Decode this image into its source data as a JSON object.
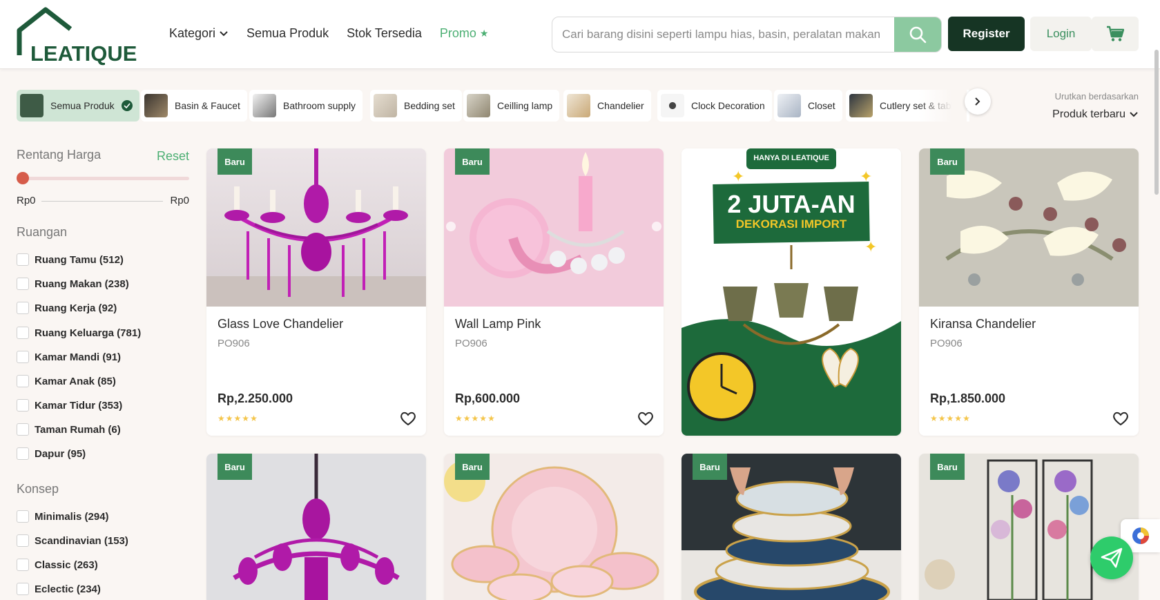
{
  "brand": {
    "name": "LEATIQUE",
    "color": "#1e5a3a"
  },
  "nav": {
    "kategori": "Kategori",
    "semua_produk": "Semua Produk",
    "stok_tersedia": "Stok Tersedia",
    "promo": "Promo"
  },
  "search": {
    "placeholder": "Cari barang disini seperti lampu hias, basin, peralatan makan",
    "icon": "search-icon"
  },
  "auth": {
    "register": "Register",
    "login": "Login",
    "cart_icon": "cart-icon"
  },
  "categories": [
    {
      "label": "Semua Produk",
      "active": true
    },
    {
      "label": "Basin & Faucet"
    },
    {
      "label": "Bathroom supply"
    },
    {
      "label": "Bedding set"
    },
    {
      "label": "Ceilling lamp"
    },
    {
      "label": "Chandelier"
    },
    {
      "label": "Clock Decoration"
    },
    {
      "label": "Closet"
    },
    {
      "label": "Cutlery set & tableware"
    }
  ],
  "sort": {
    "label": "Urutkan berdasarkan",
    "value": "Produk terbaru"
  },
  "filters": {
    "price": {
      "title": "Rentang Harga",
      "reset": "Reset",
      "min": "Rp0",
      "max": "Rp0"
    },
    "ruangan": {
      "title": "Ruangan",
      "items": [
        "Ruang Tamu (512)",
        "Ruang Makan (238)",
        "Ruang Kerja (92)",
        "Ruang Keluarga (781)",
        "Kamar Mandi (91)",
        "Kamar Anak (85)",
        "Kamar Tidur (353)",
        "Taman Rumah (6)",
        "Dapur (95)"
      ]
    },
    "konsep": {
      "title": "Konsep",
      "items": [
        "Minimalis (294)",
        "Scandinavian (153)",
        "Classic (263)",
        "Eclectic (234)"
      ]
    }
  },
  "products": [
    {
      "badge": "Baru",
      "name": "Glass Love Chandelier",
      "sku": "PO906",
      "price": "Rp,2.250.000",
      "rating": 5
    },
    {
      "badge": "Baru",
      "name": "Wall Lamp Pink",
      "sku": "PO906",
      "price": "Rp,600.000",
      "rating": 5
    },
    {
      "banner_top": "HANYA DI LEATIQUE",
      "banner_headline": "2 JUTA-AN",
      "banner_sub": "DEKORASI IMPORT"
    },
    {
      "badge": "Baru",
      "name": "Kiransa Chandelier",
      "sku": "PO906",
      "price": "Rp,1.850.000",
      "rating": 5
    },
    {
      "badge": "Baru"
    },
    {
      "badge": "Baru"
    },
    {
      "badge": "Baru"
    },
    {
      "badge": "Baru"
    }
  ],
  "colors": {
    "accent": "#4caf73",
    "dark": "#163524",
    "badge": "#3d8a5a",
    "star": "#f4c54a"
  }
}
